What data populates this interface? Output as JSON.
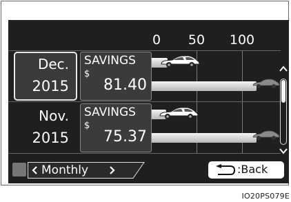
{
  "axis": {
    "ticks": [
      "0",
      "50",
      "100"
    ]
  },
  "rows": [
    {
      "month": "Dec.",
      "year": "2015",
      "savings_label": "SAVINGS",
      "currency": "$",
      "amount": "81.40",
      "selected": true
    },
    {
      "month": "Nov.",
      "year": "2015",
      "savings_label": "SAVINGS",
      "currency": "$",
      "amount": "75.37",
      "selected": false
    }
  ],
  "nav": {
    "period_label": "Monthly",
    "back_label": ":Back"
  },
  "caption": "IO20PS079E",
  "colors": {
    "screen_bg": "#1f1f1f",
    "bar": "#d8d8d8",
    "text": "#ffffff"
  },
  "icons": [
    "chevron-left-icon",
    "chevron-right-icon",
    "chevron-up-icon",
    "chevron-down-icon",
    "return-arrow-icon",
    "car-icon"
  ]
}
